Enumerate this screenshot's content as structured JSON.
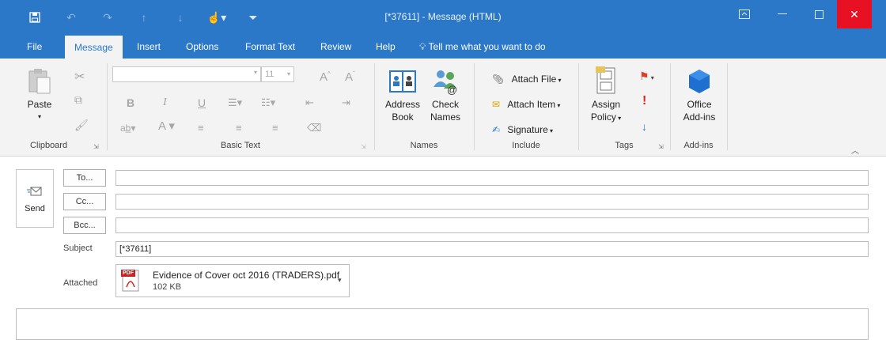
{
  "window": {
    "title": "[*37611]  -  Message (HTML)",
    "accent": "#2b78c8",
    "close_color": "#e81123"
  },
  "menu": {
    "tabs": [
      "File",
      "Message",
      "Insert",
      "Options",
      "Format Text",
      "Review",
      "Help"
    ],
    "tell_me": "Tell me what you want to do"
  },
  "ribbon": {
    "clipboard": {
      "label": "Clipboard",
      "paste": "Paste"
    },
    "basic_text": {
      "label": "Basic Text",
      "font_size": "11"
    },
    "names": {
      "label": "Names",
      "address_book": [
        "Address",
        "Book"
      ],
      "check_names": [
        "Check",
        "Names"
      ]
    },
    "include": {
      "label": "Include",
      "attach_file": "Attach File",
      "attach_item": "Attach Item",
      "signature": "Signature"
    },
    "tags": {
      "label": "Tags",
      "assign_policy": [
        "Assign",
        "Policy"
      ]
    },
    "addins": {
      "label": "Add-ins",
      "office_addins": [
        "Office",
        "Add-ins"
      ]
    }
  },
  "compose": {
    "send": "Send",
    "to": "To...",
    "cc": "Cc...",
    "bcc": "Bcc...",
    "subject_label": "Subject",
    "subject_value": "[*37611]",
    "attached_label": "Attached",
    "attachment": {
      "name": "Evidence of Cover oct 2016 (TRADERS).pdf",
      "size": "102 KB",
      "badge": "PDF"
    }
  }
}
